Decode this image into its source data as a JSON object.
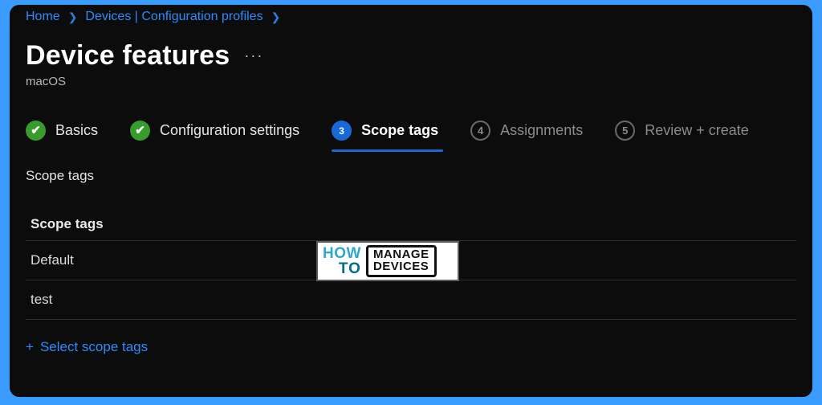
{
  "breadcrumb": {
    "items": [
      "Home",
      "Devices | Configuration profiles"
    ]
  },
  "header": {
    "title": "Device features",
    "subtitle": "macOS",
    "more": "···"
  },
  "wizard": {
    "steps": [
      {
        "label": "Basics",
        "state": "done"
      },
      {
        "label": "Configuration settings",
        "state": "done"
      },
      {
        "label": "Scope tags",
        "state": "active",
        "num": "3"
      },
      {
        "label": "Assignments",
        "state": "pending",
        "num": "4"
      },
      {
        "label": "Review + create",
        "state": "pending",
        "num": "5"
      }
    ]
  },
  "section": {
    "label": "Scope tags"
  },
  "table": {
    "header": "Scope tags",
    "rows": [
      "Default",
      "test"
    ]
  },
  "action": {
    "add": "Select scope tags",
    "plus": "+"
  },
  "watermark": {
    "how": "HOW",
    "to": "TO",
    "line1": "MANAGE",
    "line2": "DEVICES"
  }
}
